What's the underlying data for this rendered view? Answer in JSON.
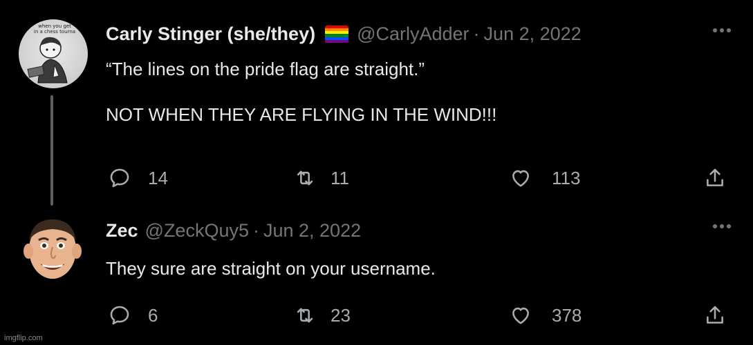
{
  "tweets": [
    {
      "display_name": "Carly Stinger (she/they)",
      "flag_icon": "rainbow-pride-flag-icon",
      "flag_colors": [
        "#e40303",
        "#ff8c00",
        "#ffed00",
        "#008026",
        "#004dff",
        "#750787"
      ],
      "handle": "@CarlyAdder",
      "separator": "·",
      "date": "Jun 2, 2022",
      "avatar_caption_line1": "when you get",
      "avatar_caption_line2": "in a chess tourna",
      "text": "“The lines on the pride flag are straight.”\n\nNOT WHEN THEY ARE FLYING IN THE WIND!!!",
      "replies": "14",
      "retweets": "11",
      "likes": "113"
    },
    {
      "display_name": "Zec",
      "handle": "@ZeckQuy5",
      "separator": "·",
      "date": "Jun 2, 2022",
      "text": "They sure are straight on your username.",
      "replies": "6",
      "retweets": "23",
      "likes": "378"
    }
  ],
  "watermark": "imgflip.com",
  "icons": {
    "reply": "reply-icon",
    "retweet": "retweet-icon",
    "like": "heart-icon",
    "share": "share-icon",
    "more": "more-options-icon"
  },
  "colors": {
    "background": "#000000",
    "text": "#e7e9ea",
    "secondary": "#71767b",
    "thread_line": "#5b5e62"
  }
}
